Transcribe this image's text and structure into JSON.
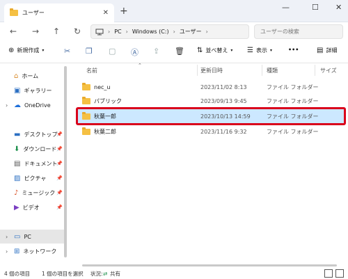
{
  "window": {
    "tab_title": "ユーザー",
    "tab_close": "✕",
    "new_tab": "+",
    "minimize": "—",
    "maximize": "☐",
    "close": "✕"
  },
  "address": {
    "path": [
      "PC",
      "Windows (C:)",
      "ユーザー"
    ],
    "search_placeholder": "ユーザーの検索"
  },
  "toolbar": {
    "new_label": "新規作成",
    "sort_label": "並べ替え",
    "view_label": "表示",
    "more_label": "•••",
    "details_label": "詳細"
  },
  "sidebar": {
    "items": [
      {
        "label": "ホーム"
      },
      {
        "label": "ギャラリー"
      },
      {
        "label": "OneDrive"
      },
      {
        "label": "デスクトップ"
      },
      {
        "label": "ダウンロード"
      },
      {
        "label": "ドキュメント"
      },
      {
        "label": "ピクチャ"
      },
      {
        "label": "ミュージック"
      },
      {
        "label": "ビデオ"
      },
      {
        "label": "PC"
      },
      {
        "label": "ネットワーク"
      }
    ]
  },
  "columns": {
    "name": "名前",
    "date": "更新日時",
    "type": "種類",
    "size": "サイズ"
  },
  "files": [
    {
      "name": "nec_u",
      "date": "2023/11/02 8:13",
      "type": "ファイル フォルダー"
    },
    {
      "name": "パブリック",
      "date": "2023/09/13 9:45",
      "type": "ファイル フォルダー"
    },
    {
      "name": "秋葉一郎",
      "date": "2023/10/13 14:59",
      "type": "ファイル フォルダー"
    },
    {
      "name": "秋葉二郎",
      "date": "2023/11/16 9:32",
      "type": "ファイル フォルダー"
    }
  ],
  "status": {
    "count": "4 個の項目",
    "selected": "1 個の項目を選択",
    "state": "状況:",
    "shared": "共有"
  },
  "colors": {
    "selection": "#cce8ff",
    "highlight": "#d9001b",
    "folder": "#f5c043"
  }
}
